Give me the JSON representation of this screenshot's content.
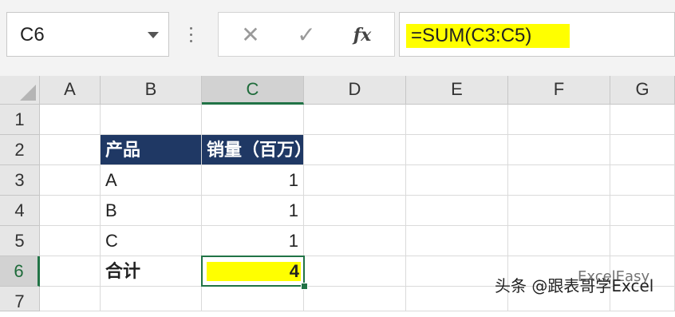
{
  "formula_bar": {
    "name_box": "C6",
    "cancel_icon": "cancel-x-icon",
    "enter_icon": "checkmark-icon",
    "fx_label": "fx",
    "formula": "=SUM(C3:C5)",
    "formula_highlight_color": "#ffff00"
  },
  "columns": [
    "A",
    "B",
    "C",
    "D",
    "E",
    "F",
    "G"
  ],
  "rows": [
    "1",
    "2",
    "3",
    "4",
    "5",
    "6",
    "7"
  ],
  "active_cell": "C6",
  "cells": {
    "b2": "产品",
    "c2": "销量（百万）",
    "b3": "A",
    "c3": "1",
    "b4": "B",
    "c4": "1",
    "b5": "C",
    "c5": "1",
    "b6": "合计",
    "c6": "4"
  },
  "colors": {
    "header_fill": "#1f3864",
    "selection": "#217346",
    "highlight": "#ffff00"
  },
  "watermark": {
    "text": "头条 @跟表哥学Excel",
    "ghost": "ExcelEasy"
  }
}
